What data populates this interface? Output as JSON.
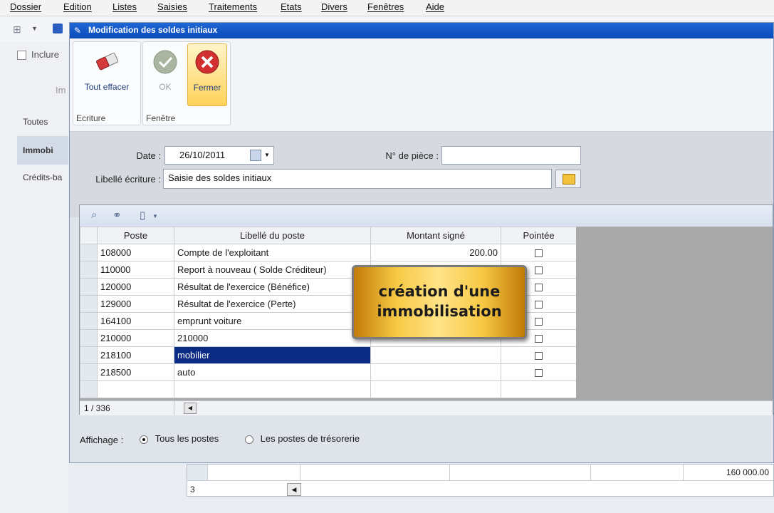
{
  "menu": [
    "Dossier",
    "Edition",
    "Listes",
    "Saisies",
    "Traitements",
    "Etats",
    "Divers",
    "Fenêtres",
    "Aide"
  ],
  "background": {
    "checkbox_label": "Inclure",
    "partial_label": "Im",
    "tabs": [
      "Toutes",
      "Immobi",
      "Crédits-ba"
    ],
    "bottom_grid_value": "160 000.00",
    "bottom_grid_counter": "3"
  },
  "dialog": {
    "title": "Modification des soldes initiaux",
    "ribbon": {
      "groups": [
        {
          "label": "Ecriture",
          "buttons": [
            {
              "label": "Tout effacer",
              "icon": "eraser-icon"
            }
          ]
        },
        {
          "label": "Fenêtre",
          "buttons": [
            {
              "label": "OK",
              "icon": "check-icon",
              "disabled": true
            },
            {
              "label": "Fermer",
              "icon": "close-icon"
            }
          ]
        }
      ]
    },
    "form": {
      "date_label": "Date :",
      "date_value": "26/10/2011",
      "piece_label": "N° de pièce :",
      "piece_value": "",
      "libelle_label": "Libellé écriture :",
      "libelle_value": "Saisie des soldes initiaux"
    },
    "grid": {
      "columns": [
        "Poste",
        "Libellé du poste",
        "Montant signé",
        "Pointée"
      ],
      "rows": [
        {
          "poste": "108000",
          "libelle": "Compte de l'exploitant",
          "montant": "200.00"
        },
        {
          "poste": "110000",
          "libelle": "Report à nouveau ( Solde Créditeur)",
          "montant": ""
        },
        {
          "poste": "120000",
          "libelle": "Résultat de l'exercice (Bénéfice)",
          "montant": ""
        },
        {
          "poste": "129000",
          "libelle": "Résultat de l'exercice (Perte)",
          "montant": ""
        },
        {
          "poste": "164100",
          "libelle": "emprunt voiture",
          "montant": ""
        },
        {
          "poste": "210000",
          "libelle": "210000",
          "montant": ""
        },
        {
          "poste": "218100",
          "libelle": "mobilier",
          "montant": "",
          "active": true
        },
        {
          "poste": "218500",
          "libelle": "auto",
          "montant": ""
        }
      ],
      "status": "1 / 336"
    },
    "affichage": {
      "label": "Affichage :",
      "options": [
        "Tous les postes",
        "Les postes de trésorerie"
      ],
      "selected": 0
    }
  },
  "overlay": {
    "line1": "création d'une",
    "line2": "immobilisation"
  }
}
